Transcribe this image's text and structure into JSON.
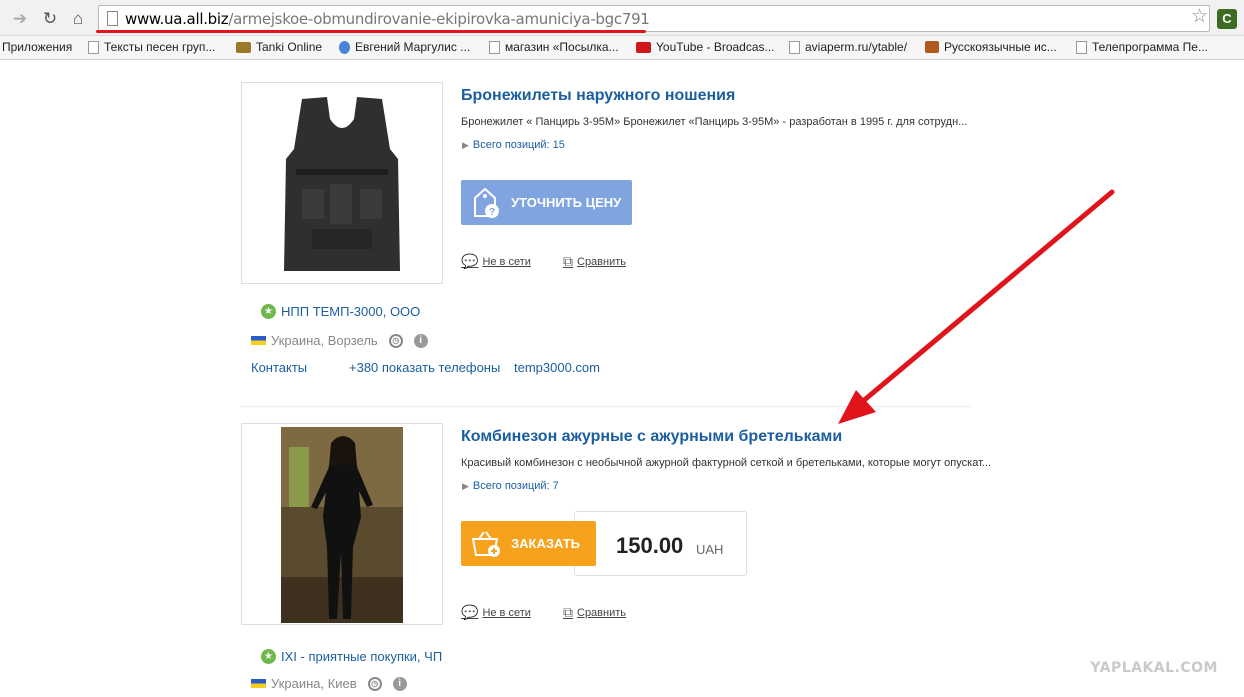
{
  "browser": {
    "url_domain": "www.ua.all.biz",
    "url_path": "/armejskoe-obmundirovanie-ekipirovka-amuniciya-bgc791"
  },
  "bookmarks": [
    {
      "label": "Приложения",
      "icon": "apps-icon"
    },
    {
      "label": "Тексты песен груп...",
      "icon": "page-icon"
    },
    {
      "label": "Tanki Online",
      "icon": "tank-icon"
    },
    {
      "label": "Евгений Маргулис ...",
      "icon": "drop-icon"
    },
    {
      "label": "магазин «Посылка...",
      "icon": "page-icon"
    },
    {
      "label": "YouTube - Broadcas...",
      "icon": "youtube-icon"
    },
    {
      "label": "aviaperm.ru/ytable/",
      "icon": "page-icon"
    },
    {
      "label": "Русскоязычные ис...",
      "icon": "cup-icon"
    },
    {
      "label": "Телепрограмма Пе...",
      "icon": "page-icon"
    }
  ],
  "listing1": {
    "title": "Бронежилеты наружного ношения",
    "description": "Бронежилет « Панцирь 3-95М» Бронежилет «Панцирь 3-95М» - разработан в 1995 г. для сотрудн...",
    "positions": "Всего позиций: 15",
    "button_label": "УТОЧНИТЬ ЦЕНУ",
    "status": "Не в сети",
    "compare": "Сравнить",
    "seller": "НПП ТЕМП-3000, ООО",
    "region": "Украина, Ворзель",
    "contacts": "Контакты",
    "phone": "+380 показать телефоны",
    "website": "temp3000.com"
  },
  "listing2": {
    "title": "Комбинезон ажурные с ажурными бретельками",
    "description": "Красивый комбинезон с необычной ажурной фактурной сеткой и бретельками, которые могут опускат...",
    "positions": "Всего позиций: 7",
    "button_label": "ЗАКАЗАТЬ",
    "price": "150.00",
    "currency": "UAH",
    "status": "Не в сети",
    "compare": "Сравнить",
    "seller": "IXI - приятные покупки, ЧП",
    "region": "Украина, Киев"
  },
  "watermark": "YAPLAKAL.COM",
  "colors": {
    "link": "#1b5fa0",
    "price_button": "#7fa4df",
    "order_button": "#f6a21d",
    "annotation": "#e0151b"
  }
}
